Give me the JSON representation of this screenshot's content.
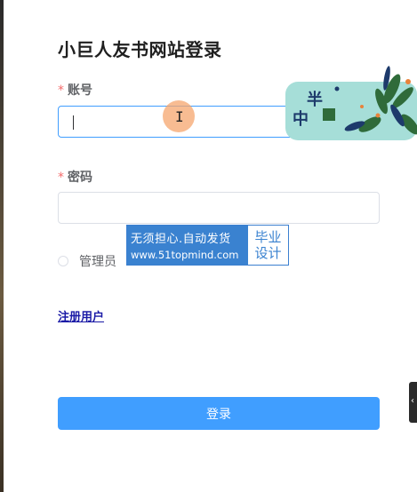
{
  "form": {
    "title": "小巨人友书网站登录",
    "account": {
      "required_mark": "*",
      "label": "账号",
      "value": ""
    },
    "password": {
      "required_mark": "*",
      "label": "密码",
      "value": ""
    },
    "role": {
      "label": "管理员",
      "selected": false
    },
    "register_link": "注册用户",
    "login_button": "登录"
  },
  "overlay": {
    "watermark": {
      "line1": "无须担心.自动发货",
      "line2": "www.51topmind.com",
      "right1": "毕业",
      "right2": "设计"
    },
    "badge": {
      "char1": "半",
      "char2": "中"
    },
    "side_tab_glyph": "‹"
  },
  "colors": {
    "primary": "#409eff",
    "required": "#f56c6c",
    "link": "#1a1aa6",
    "watermark_blue": "#3a82d0",
    "badge_teal": "#a6ded8"
  }
}
